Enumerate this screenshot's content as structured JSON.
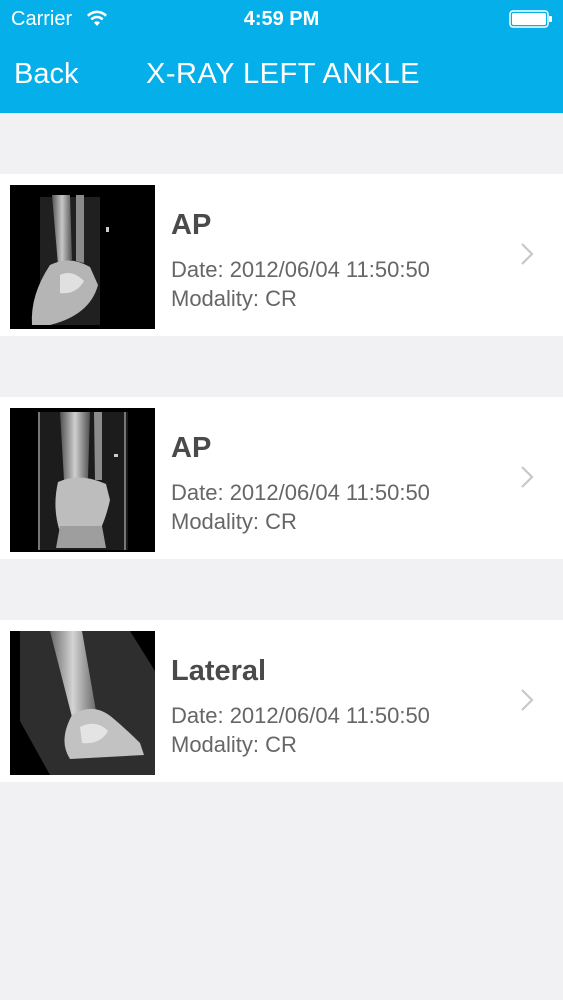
{
  "status_bar": {
    "carrier": "Carrier",
    "time": "4:59 PM",
    "icons": [
      "wifi-icon",
      "battery-icon"
    ]
  },
  "nav": {
    "back_label": "Back",
    "title": "X-RAY LEFT ANKLE"
  },
  "colors": {
    "header_bg": "#05b0ea",
    "page_bg": "#f1f1f3",
    "row_bg": "#ffffff"
  },
  "items": [
    {
      "title": "AP",
      "date": "Date: 2012/06/04 11:50:50",
      "modality": "Modality: CR",
      "thumbnail": "x-ray-ankle-ap-thumbnail"
    },
    {
      "title": "AP",
      "date": "Date: 2012/06/04 11:50:50",
      "modality": "Modality: CR",
      "thumbnail": "x-ray-ankle-ap-thumbnail"
    },
    {
      "title": "Lateral",
      "date": "Date: 2012/06/04 11:50:50",
      "modality": "Modality: CR",
      "thumbnail": "x-ray-ankle-lateral-thumbnail"
    }
  ]
}
